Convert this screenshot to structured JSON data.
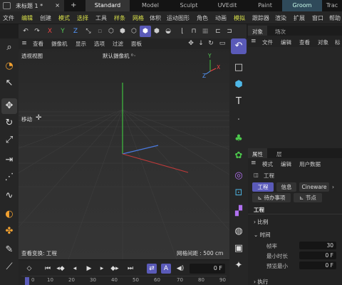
{
  "window": {
    "doc_tab": "未标题 1 *",
    "workspace_tabs": [
      "Standard",
      "Model",
      "Sculpt",
      "UVEdit",
      "Paint",
      "Groom",
      "Trac"
    ]
  },
  "menubar": {
    "items": [
      "文件",
      "编辑",
      "创建",
      "模式",
      "选择",
      "工具",
      "样条",
      "网格",
      "体积",
      "运动图形",
      "角色",
      "动画",
      "模拟",
      "跟踪器",
      "渲染",
      "扩展",
      "窗口",
      "帮助"
    ]
  },
  "toolbar": {
    "axis_x": "X",
    "axis_y": "Y",
    "axis_z": "Z"
  },
  "viewport": {
    "menu": [
      "查看",
      "摄像机",
      "显示",
      "选项",
      "过滤",
      "面板"
    ],
    "view_name": "透视视图",
    "camera_label": "默认摄像机 ⁰᛫",
    "tool_label": "移动",
    "status_left": "查看变换: 工程",
    "grid_spacing": "网格间距 : 500 cm",
    "axis_labels": {
      "y": "Y",
      "x": "X",
      "z": "Z"
    }
  },
  "timeline": {
    "frame_value": "0 F",
    "ruler": [
      "0",
      "10",
      "20",
      "30",
      "40",
      "50",
      "60",
      "70",
      "80",
      "90"
    ]
  },
  "objects_panel": {
    "tabs": [
      "对象",
      "场次"
    ],
    "menu": [
      "文件",
      "编辑",
      "查看",
      "对象",
      "标"
    ]
  },
  "attributes_panel": {
    "tabs": [
      "属性",
      "层"
    ],
    "menu": [
      "模式",
      "编辑",
      "用户数据"
    ],
    "object_name": "工程",
    "buttons": [
      "工程",
      "信息",
      "Cineware",
      "待办事项",
      "节点"
    ],
    "section_title": "工程",
    "sections": [
      "比例",
      "时间",
      "执行"
    ],
    "fields": [
      {
        "label": "帧率",
        "value": "30"
      },
      {
        "label": "最小时长",
        "value": "0 F"
      },
      {
        "label": "预览最小",
        "value": "0 F"
      }
    ]
  },
  "colors": {
    "accent": "#5a5ab8",
    "highlight_menu": "#d8e04a",
    "axis_x": "#e44444",
    "axis_y": "#55cc55",
    "axis_z": "#5599ff"
  }
}
